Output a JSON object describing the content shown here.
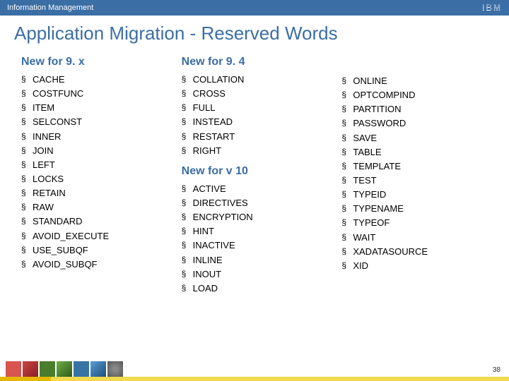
{
  "header": {
    "subtitle": "Information Management",
    "logo_text": "IBM"
  },
  "title": "Application Migration - Reserved Words",
  "columns": [
    {
      "sections": [
        {
          "heading": "New for 9. x",
          "items": [
            "CACHE",
            "COSTFUNC",
            "ITEM",
            "SELCONST",
            "INNER",
            "JOIN",
            "LEFT",
            "LOCKS",
            "RETAIN",
            "RAW",
            "STANDARD",
            "AVOID_EXECUTE",
            "USE_SUBQF",
            "AVOID_SUBQF"
          ]
        }
      ]
    },
    {
      "sections": [
        {
          "heading": "New for 9. 4",
          "items": [
            "COLLATION",
            "CROSS",
            "FULL",
            "INSTEAD",
            "RESTART",
            "RIGHT"
          ]
        },
        {
          "heading": "New for v 10",
          "items": [
            "ACTIVE",
            "DIRECTIVES",
            "ENCRYPTION",
            "HINT",
            "INACTIVE",
            "INLINE",
            "INOUT",
            "LOAD"
          ]
        }
      ]
    },
    {
      "sections": [
        {
          "heading": "",
          "items": [
            "ONLINE",
            "OPTCOMPIND",
            "PARTITION",
            "PASSWORD",
            "SAVE",
            "TABLE",
            "TEMPLATE",
            "TEST",
            "TYPEID",
            "TYPENAME",
            "TYPEOF",
            "WAIT",
            "XADATASOURCE",
            "XID"
          ]
        }
      ]
    }
  ],
  "page_number": "38"
}
